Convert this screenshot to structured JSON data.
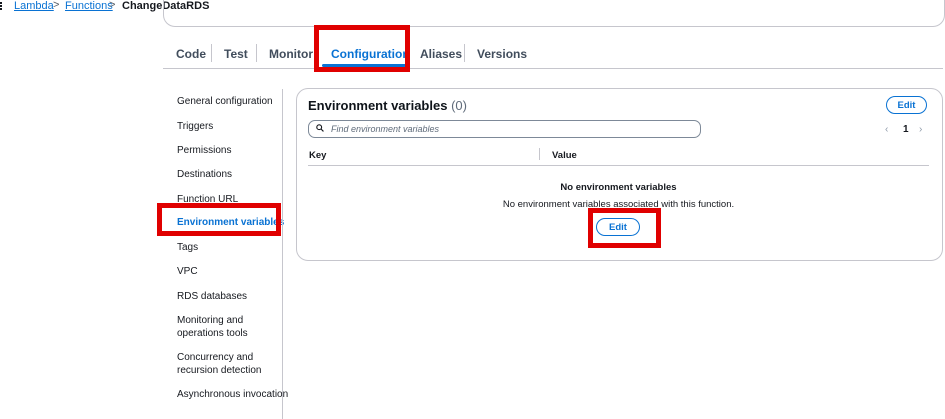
{
  "breadcrumb": {
    "items": [
      "Lambda",
      "Functions"
    ],
    "current": "ChangeDataRDS",
    "separator": ">"
  },
  "tabs": [
    "Code",
    "Test",
    "Monitor",
    "Configuration",
    "Aliases",
    "Versions"
  ],
  "active_tab": "Configuration",
  "nav": {
    "items": [
      "General configuration",
      "Triggers",
      "Permissions",
      "Destinations",
      "Function URL",
      "Environment variables",
      "Tags",
      "VPC",
      "RDS databases",
      "Monitoring and\noperations tools",
      "Concurrency and\nrecursion detection",
      "Asynchronous invocation"
    ],
    "active": "Environment variables"
  },
  "env": {
    "title": "Environment variables",
    "count": "(0)",
    "edit_label": "Edit",
    "search_placeholder": "Find environment variables",
    "page": "1",
    "columns": [
      "Key",
      "Value"
    ],
    "empty_title": "No environment variables",
    "empty_desc": "No environment variables associated with this function.",
    "empty_edit_label": "Edit"
  },
  "colors": {
    "accent": "#0972d3",
    "highlight": "#e00000"
  }
}
